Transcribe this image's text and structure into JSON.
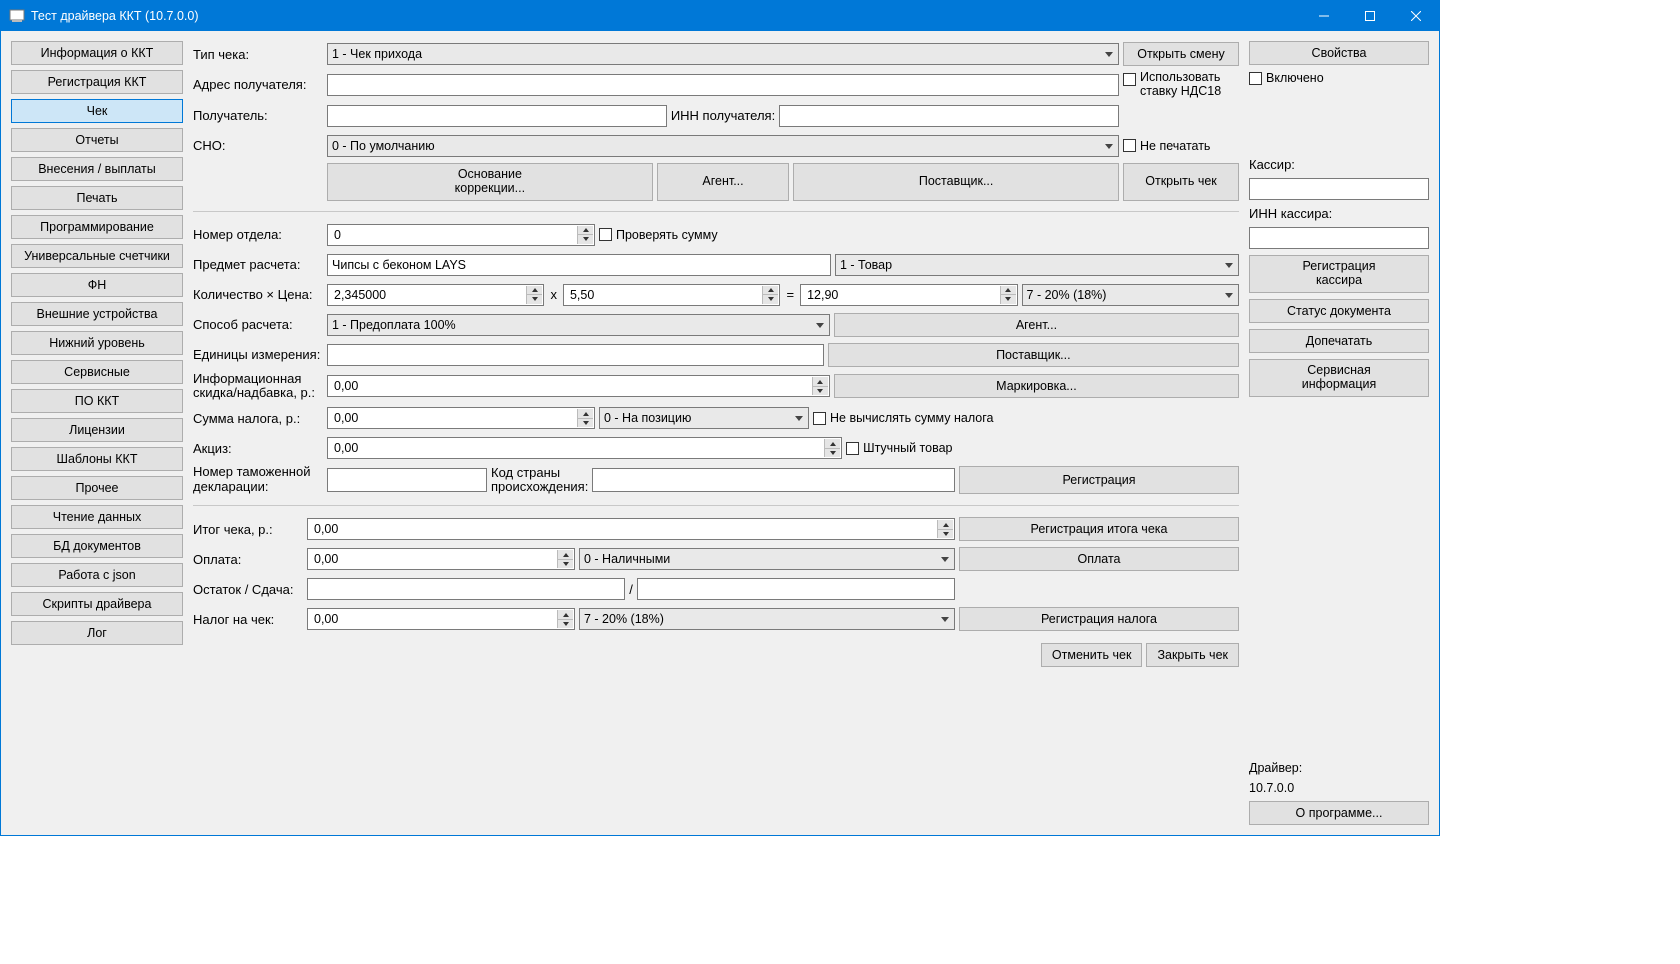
{
  "window": {
    "title": "Тест драйвера ККТ (10.7.0.0)"
  },
  "nav": {
    "items": [
      "Информация о ККТ",
      "Регистрация ККТ",
      "Чек",
      "Отчеты",
      "Внесения / выплаты",
      "Печать",
      "Программирование",
      "Универсальные счетчики",
      "ФН",
      "Внешние устройства",
      "Нижний уровень",
      "Сервисные",
      "ПО ККТ",
      "Лицензии",
      "Шаблоны ККТ",
      "Прочее",
      "Чтение данных",
      "БД документов",
      "Работа с json",
      "Скрипты драйвера",
      "Лог"
    ],
    "active_index": 2
  },
  "form": {
    "lbl_check_type": "Тип чека:",
    "val_check_type": "1 - Чек прихода",
    "btn_open_shift": "Открыть смену",
    "lbl_recipient_addr": "Адрес получателя:",
    "chk_use_vat18": "Использовать\nставку НДС18",
    "lbl_recipient": "Получатель:",
    "lbl_recipient_inn": "ИНН получателя:",
    "lbl_sno": "СНО:",
    "val_sno": "0 - По умолчанию",
    "chk_no_print": "Не печатать",
    "btn_correction_basis": "Основание\nкоррекции...",
    "btn_agent": "Агент...",
    "btn_supplier": "Поставщик...",
    "btn_open_check": "Открыть чек",
    "lbl_dept_num": "Номер отдела:",
    "val_dept_num": "0",
    "chk_check_sum": "Проверять сумму",
    "lbl_subject": "Предмет расчета:",
    "val_subject": "Чипсы с беконом LAYS",
    "val_subject_type": "1 - Товар",
    "lbl_qty_price": "Количество × Цена:",
    "val_qty": "2,345000",
    "mul_sign": "x",
    "val_price": "5,50",
    "eq_sign": "=",
    "val_total_item": "12,90",
    "val_tax_rate": "7 - 20% (18%)",
    "lbl_calc_method": "Способ расчета:",
    "val_calc_method": "1 - Предоплата 100%",
    "btn_agent2": "Агент...",
    "lbl_units": "Единицы измерения:",
    "btn_supplier2": "Поставщик...",
    "lbl_info_discount": "Информационная\nскидка/надбавка, р.:",
    "val_info_discount": "0,00",
    "btn_marking": "Маркировка...",
    "lbl_tax_sum": "Сумма налога, р.:",
    "val_tax_sum": "0,00",
    "val_tax_mode": "0 - На позицию",
    "chk_no_calc_tax": "Не вычислять сумму налога",
    "lbl_excise": "Акциз:",
    "val_excise": "0,00",
    "chk_piece_goods": "Штучный товар",
    "lbl_customs_decl": "Номер таможенной\nдекларации:",
    "lbl_country_code": "Код страны\nпроисхождения:",
    "btn_registration": "Регистрация",
    "lbl_check_total": "Итог чека, р.:",
    "val_check_total": "0,00",
    "btn_reg_total": "Регистрация итога чека",
    "lbl_payment": "Оплата:",
    "val_payment": "0,00",
    "val_payment_type": "0 - Наличными",
    "btn_payment": "Оплата",
    "lbl_remainder": "Остаток / Сдача:",
    "slash": "/",
    "lbl_check_tax": "Налог на чек:",
    "val_check_tax": "0,00",
    "val_check_tax_rate": "7 - 20% (18%)",
    "btn_reg_tax": "Регистрация налога",
    "btn_cancel_check": "Отменить чек",
    "btn_close_check": "Закрыть чек"
  },
  "right": {
    "btn_properties": "Свойства",
    "chk_enabled": "Включено",
    "lbl_cashier": "Кассир:",
    "lbl_cashier_inn": "ИНН кассира:",
    "btn_reg_cashier": "Регистрация\nкассира",
    "btn_doc_status": "Статус документа",
    "btn_reprint": "Допечатать",
    "btn_service_info": "Сервисная\nинформация",
    "lbl_driver": "Драйвер:",
    "val_driver": "10.7.0.0",
    "btn_about": "О программе..."
  }
}
